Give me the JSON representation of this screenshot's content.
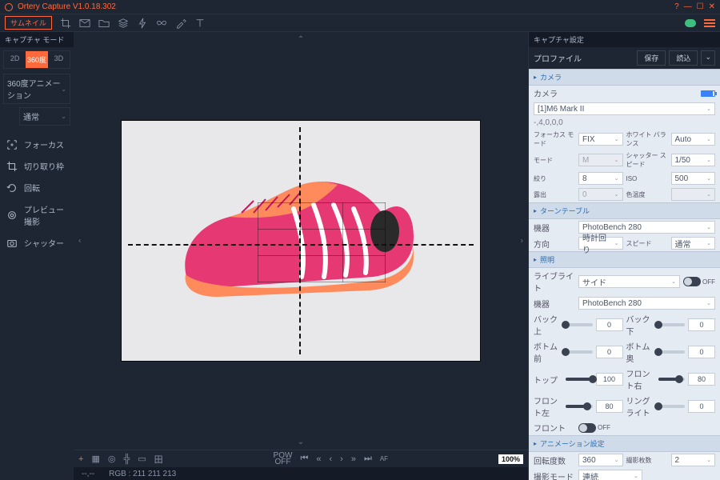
{
  "app": {
    "title": "Ortery Capture V1.0.18.302"
  },
  "toolbar": {
    "thumbnail": "サムネイル"
  },
  "left": {
    "capture_mode_hd": "キャプチャ モード",
    "modes": {
      "m2d": "2D",
      "m360": "360度",
      "m3d": "3D"
    },
    "dd1": "360度アニメーション",
    "dd2": "通常",
    "tools": {
      "focus": "フォーカス",
      "crop": "切り取り枠",
      "rotate": "回転",
      "preview": "プレビュー撮影",
      "shutter": "シャッター"
    }
  },
  "canvas": {
    "pow": "POW",
    "off": "OFF",
    "zoom": "100%"
  },
  "footer": {
    "xy": "--,--",
    "rgb": "RGB : 211 211 213"
  },
  "right": {
    "hd": "キャプチャ設定",
    "profile": "プロファイル",
    "save": "保存",
    "load": "読込",
    "grp_camera": "カメラ",
    "camera_lbl": "カメラ",
    "camera_val": "[1]M6 Mark II",
    "camera_meta": "-,4,0,0,0",
    "focus_mode_lbl": "フォーカス モード",
    "focus_mode_val": "FIX",
    "wb_lbl": "ホワイト バランス",
    "wb_val": "Auto",
    "mode_lbl": "モード",
    "mode_val": "M",
    "ss_lbl": "シャッター スピード",
    "ss_val": "1/50",
    "ap_lbl": "絞り",
    "ap_val": "8",
    "iso_lbl": "ISO",
    "iso_val": "500",
    "exp_lbl": "露出",
    "exp_val": "0",
    "ct_lbl": "色温度",
    "ct_val": "",
    "grp_turntable": "ターンテーブル",
    "tt_dev_lbl": "機器",
    "tt_dev_val": "PhotoBench 280",
    "tt_dir_lbl": "方向",
    "tt_dir_val": "時計回り",
    "tt_spd_lbl": "スピード",
    "tt_spd_val": "通常",
    "grp_light": "照明",
    "livelight_lbl": "ライブライト",
    "livelight_val": "サイド",
    "off": "OFF",
    "light_dev_lbl": "機器",
    "light_dev_val": "PhotoBench 280",
    "back_top": "バック上",
    "back_bottom": "バック下",
    "bottom_front": "ボトム前",
    "bottom_back": "ボトム奥",
    "top": "トップ",
    "front_right": "フロント右",
    "front_left": "フロント左",
    "ringlight": "リングライト",
    "front": "フロント",
    "v0": "0",
    "v100": "100",
    "v80": "80",
    "grp_anim": "アニメーション設定",
    "rot_deg_lbl": "回転度数",
    "rot_deg_val": "360",
    "frames_lbl": "撮影枚数",
    "frames_val": "2",
    "cap_mode_lbl": "撮影モード",
    "cap_mode_val": "連続"
  }
}
